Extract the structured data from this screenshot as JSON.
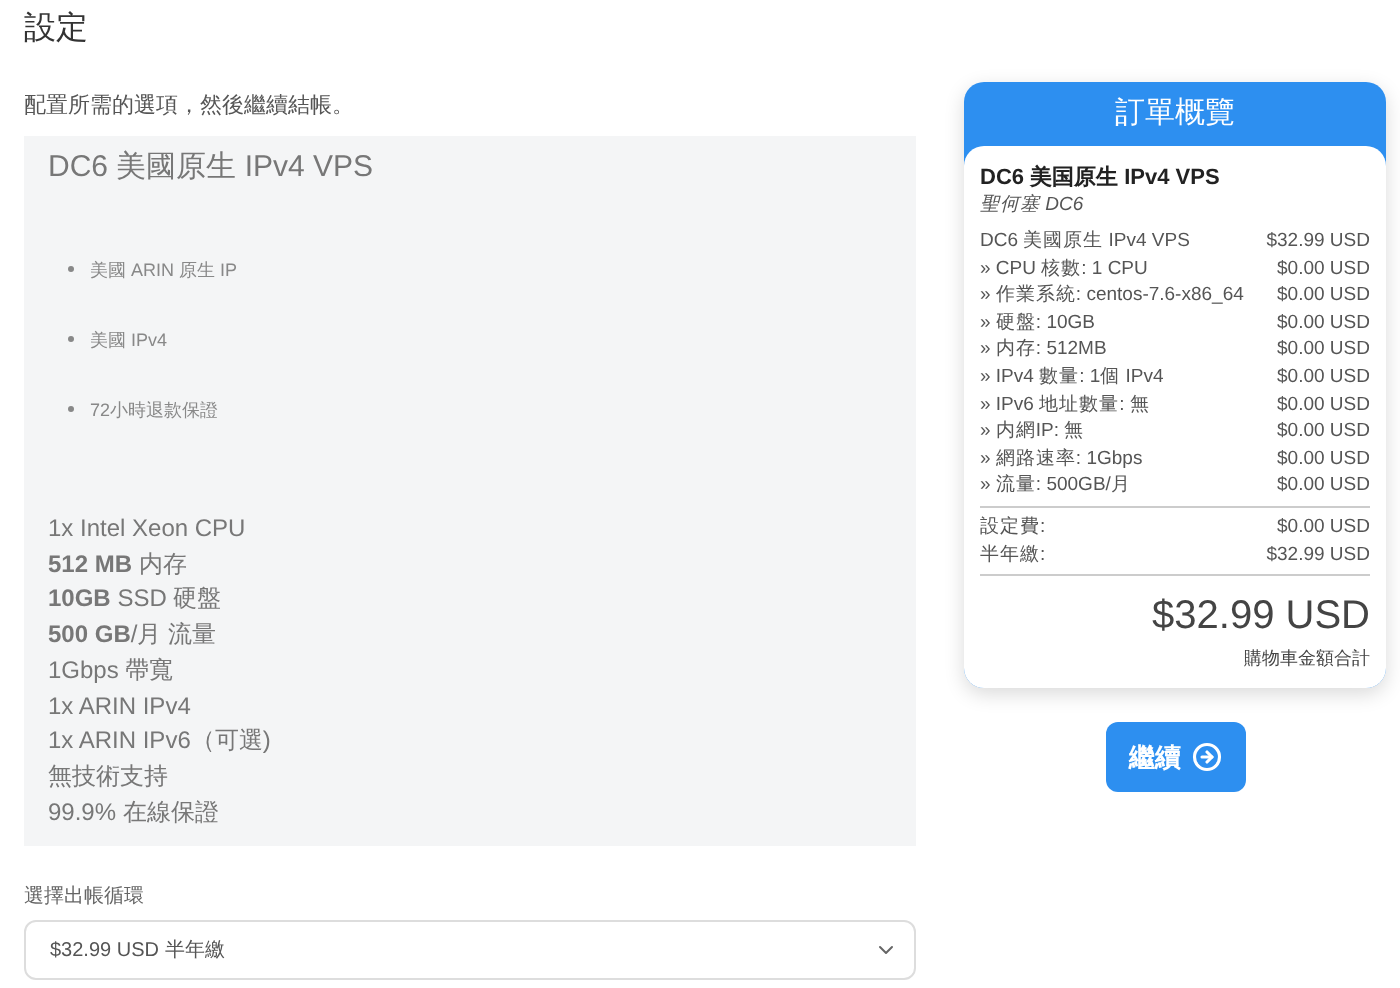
{
  "page": {
    "title": "設定",
    "subtitle": "配置所需的選項，然後繼續結帳。"
  },
  "product": {
    "name": "DC6 美國原生 IPv4 VPS",
    "features": [
      "美國 ARIN 原生 IP",
      "美國 IPv4",
      "72小時退款保證"
    ],
    "specs": [
      "1x Intel Xeon CPU",
      "**512 MB** 内存",
      "**10GB** SSD 硬盤",
      "**500 GB**/月 流量",
      "1Gbps 帶寬",
      "1x ARIN IPv4",
      "1x ARIN IPv6（可選)",
      "無技術支持",
      "99.9% 在線保證"
    ]
  },
  "billing": {
    "label": "選擇出帳循環",
    "value": "$32.99 USD 半年繳"
  },
  "summary": {
    "title": "訂單概覽",
    "product": "DC6 美国原生 IPv4 VPS",
    "group": "聖何塞 DC6",
    "lines": [
      {
        "label": "DC6 美國原生 IPv4 VPS",
        "price": "$32.99 USD"
      },
      {
        "label": "» CPU 核數: 1 CPU",
        "price": "$0.00 USD"
      },
      {
        "label": "» 作業系統: centos-7.6-x86_64",
        "price": "$0.00 USD"
      },
      {
        "label": "» 硬盤: 10GB",
        "price": "$0.00 USD"
      },
      {
        "label": "» 内存: 512MB",
        "price": "$0.00 USD"
      },
      {
        "label": "» IPv4 數量: 1個 IPv4",
        "price": "$0.00 USD"
      },
      {
        "label": "» IPv6 地址數量: 無",
        "price": "$0.00 USD"
      },
      {
        "label": "» 内網IP: 無",
        "price": "$0.00 USD"
      },
      {
        "label": "» 網路速率: 1Gbps",
        "price": "$0.00 USD"
      },
      {
        "label": "» 流量: 500GB/月",
        "price": "$0.00 USD"
      }
    ],
    "totals": [
      {
        "label": "設定費:",
        "price": "$0.00 USD"
      },
      {
        "label": "半年繳:",
        "price": "$32.99 USD"
      }
    ],
    "total": "$32.99 USD",
    "total_label": "購物車金額合計"
  },
  "continue_button": "繼續"
}
